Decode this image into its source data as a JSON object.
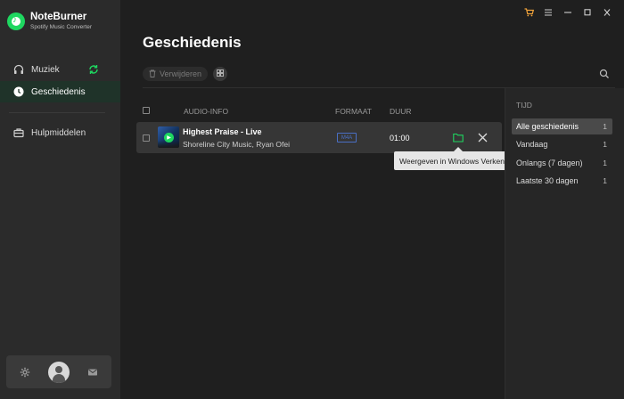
{
  "app": {
    "name": "NoteBurner",
    "subtitle": "Spotify Music Converter",
    "brand_color": "#1ed760"
  },
  "window_controls": [
    {
      "name": "cart-icon",
      "glyph": "🛒"
    },
    {
      "name": "menu-icon",
      "glyph": "≡"
    },
    {
      "name": "minimize-icon",
      "glyph": "—"
    },
    {
      "name": "maximize-icon",
      "glyph": "☐"
    },
    {
      "name": "close-window-icon",
      "glyph": "✕"
    }
  ],
  "sidebar": {
    "items": [
      {
        "label": "Muziek",
        "icon": "headphones-icon",
        "active": false
      },
      {
        "label": "Geschiedenis",
        "icon": "clock-icon",
        "active": true
      },
      {
        "label": "Hulpmiddelen",
        "icon": "toolbox-icon",
        "active": false
      }
    ],
    "bottom": [
      "gear-icon",
      "avatar",
      "mail-icon"
    ]
  },
  "main": {
    "title": "Geschiedenis",
    "toolbar": {
      "delete_label": "Verwijderen"
    },
    "table": {
      "headers": {
        "audio": "AUDIO-INFO",
        "format": "FORMAAT",
        "duration": "DUUR"
      },
      "rows": [
        {
          "title": "Highest Praise - Live",
          "artist": "Shoreline City Music, Ryan Ofei",
          "format": "M4A",
          "duration": "01:00"
        }
      ]
    },
    "tooltip": "Weergeven in Windows Verkenner"
  },
  "filter": {
    "heading": "TIJD",
    "items": [
      {
        "label": "Alle geschiedenis",
        "count": "1",
        "active": true
      },
      {
        "label": "Vandaag",
        "count": "1",
        "active": false
      },
      {
        "label": "Onlangs (7 dagen)",
        "count": "1",
        "active": false
      },
      {
        "label": "Laatste 30 dagen",
        "count": "1",
        "active": false
      }
    ]
  }
}
